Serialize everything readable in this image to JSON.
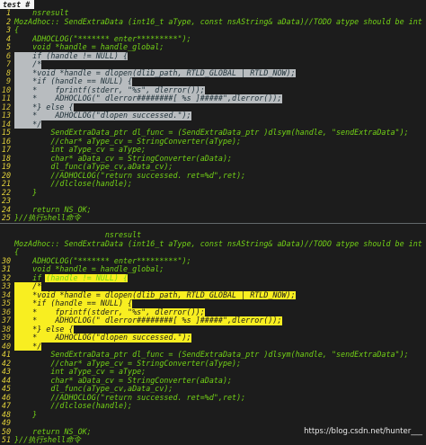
{
  "tab": {
    "label": "test #"
  },
  "lines": [
    {
      "n": "1",
      "text": "    nsresult",
      "hl": ""
    },
    {
      "n": "2",
      "text": "MozAdhoc:: SendExtraData (int16_t aType, const nsAString& aData)//TODO atype should be int",
      "hl": ""
    },
    {
      "n": "3",
      "text": "{",
      "hl": ""
    },
    {
      "n": "4",
      "text": "    ADHOCLOG(\"******* enter*********\");",
      "hl": ""
    },
    {
      "n": "5",
      "text": "    void *handle = handle_global;",
      "hl": ""
    },
    {
      "n": "6",
      "text": "    if (handle != NULL) {",
      "hl": "gray"
    },
    {
      "n": "7",
      "text": "    /*",
      "hl": "gray"
    },
    {
      "n": "8",
      "text": "    *void *handle = dlopen(dlib_path, RTLD_GLOBAL | RTLD_NOW);",
      "hl": "gray"
    },
    {
      "n": "9",
      "text": "    *if (handle == NULL) {",
      "hl": "gray"
    },
    {
      "n": "10",
      "text": "    *    fprintf(stderr, \"%s\", dlerror());",
      "hl": "gray"
    },
    {
      "n": "11",
      "text": "    *    ADHOCLOG(\" dlerror########[ %s ]#####\",dlerror());",
      "hl": "gray"
    },
    {
      "n": "12",
      "text": "    *} else {",
      "hl": "gray"
    },
    {
      "n": "13",
      "text": "    *    ADHOCLOG(\"dlopen successed.\");",
      "hl": "gray"
    },
    {
      "n": "14",
      "text": "    */",
      "hl": "gray"
    },
    {
      "n": "15",
      "text": "        SendExtraData_ptr dl_func = (SendExtraData_ptr )dlsym(handle, \"sendExtraData\");",
      "hl": ""
    },
    {
      "n": "16",
      "text": "        //char* aType_cv = StringConverter(aType);",
      "hl": ""
    },
    {
      "n": "17",
      "text": "        int aType_cv = aType;",
      "hl": ""
    },
    {
      "n": "18",
      "text": "        char* aData_cv = StringConverter(aData);",
      "hl": ""
    },
    {
      "n": "19",
      "text": "        dl_func(aType_cv,aData_cv);",
      "hl": ""
    },
    {
      "n": "20",
      "text": "        //ADHOCLOG(\"return successed. ret=%d\",ret);",
      "hl": ""
    },
    {
      "n": "21",
      "text": "        //dlclose(handle);",
      "hl": ""
    },
    {
      "n": "22",
      "text": "    }",
      "hl": ""
    },
    {
      "n": "23",
      "text": "",
      "hl": ""
    },
    {
      "n": "24",
      "text": "    return NS_OK;",
      "hl": ""
    },
    {
      "n": "25",
      "text": "}//执行shell命令",
      "hl": "",
      "divider": true
    },
    {
      "n": "",
      "text": "",
      "hl": ""
    },
    {
      "n": "",
      "text": "                    nsresult",
      "hl": ""
    },
    {
      "n": "",
      "text": "MozAdhoc:: SendExtraData (int16_t aType, const nsAString& aData)//TODO atype should be int",
      "hl": ""
    },
    {
      "n": "",
      "text": "{",
      "hl": ""
    },
    {
      "n": "30",
      "text": "    ADHOCLOG(\"******* enter*********\");",
      "hl": ""
    },
    {
      "n": "31",
      "text": "    void *handle = handle_global;",
      "hl": ""
    },
    {
      "n": "32",
      "text": "    if (handle != NULL) {",
      "hl": "yellow-partial"
    },
    {
      "n": "33",
      "text": "    /*",
      "hl": "yellow"
    },
    {
      "n": "34",
      "text": "    *void *handle = dlopen(dlib_path, RTLD_GLOBAL | RTLD_NOW);",
      "hl": "yellow"
    },
    {
      "n": "35",
      "text": "    *if (handle == NULL) {",
      "hl": "yellow"
    },
    {
      "n": "36",
      "text": "    *    fprintf(stderr, \"%s\", dlerror());",
      "hl": "yellow"
    },
    {
      "n": "37",
      "text": "    *    ADHOCLOG(\" dlerror########[ %s ]#####\",dlerror());",
      "hl": "yellow"
    },
    {
      "n": "38",
      "text": "    *} else {",
      "hl": "yellow"
    },
    {
      "n": "39",
      "text": "    *    ADHOCLOG(\"dlopen successed.\");",
      "hl": "yellow"
    },
    {
      "n": "40",
      "text": "    */",
      "hl": "yellow"
    },
    {
      "n": "41",
      "text": "        SendExtraData_ptr dl_func = (SendExtraData_ptr )dlsym(handle, \"sendExtraData\");",
      "hl": ""
    },
    {
      "n": "42",
      "text": "        //char* aType_cv = StringConverter(aType);",
      "hl": ""
    },
    {
      "n": "43",
      "text": "        int aType_cv = aType;",
      "hl": ""
    },
    {
      "n": "44",
      "text": "        char* aData_cv = StringConverter(aData);",
      "hl": ""
    },
    {
      "n": "45",
      "text": "        dl_func(aType_cv,aData_cv);",
      "hl": ""
    },
    {
      "n": "46",
      "text": "        //ADHOCLOG(\"return successed. ret=%d\",ret);",
      "hl": ""
    },
    {
      "n": "47",
      "text": "        //dlclose(handle);",
      "hl": ""
    },
    {
      "n": "48",
      "text": "    }",
      "hl": ""
    },
    {
      "n": "49",
      "text": "",
      "hl": ""
    },
    {
      "n": "50",
      "text": "    return NS_OK;",
      "hl": ""
    },
    {
      "n": "51",
      "text": "}//执行shell命令",
      "hl": ""
    }
  ],
  "watermark": "https://blog.csdn.net/hunter___",
  "colors": {
    "background": "#1c1c1c",
    "code_text": "#73d216",
    "line_number": "#e2d23a",
    "highlight_gray": "#b8bcbf",
    "highlight_yellow": "#f8ee21"
  }
}
